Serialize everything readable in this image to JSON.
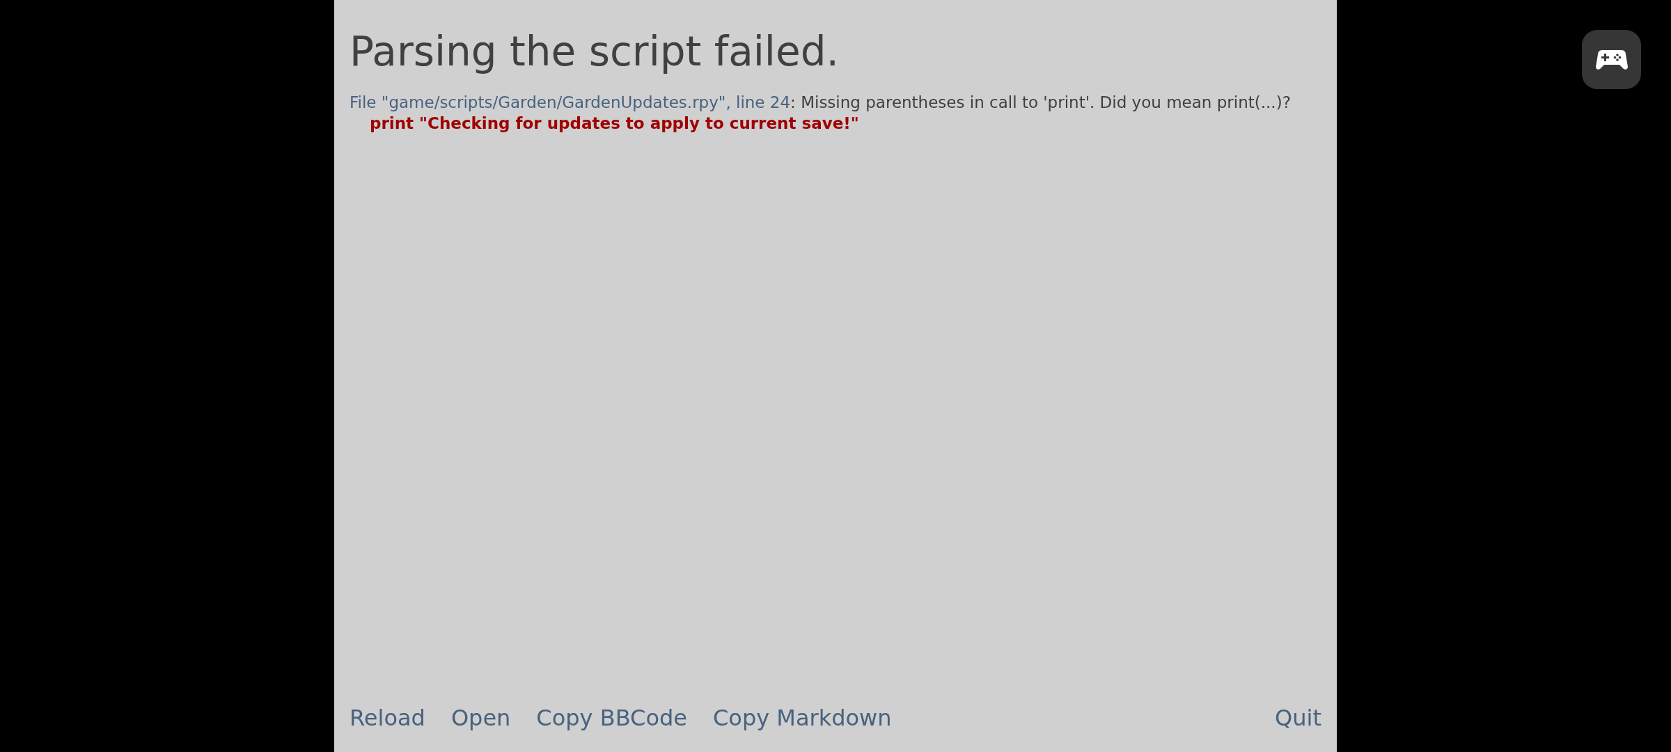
{
  "title": "Parsing the script failed.",
  "error": {
    "location": "File \"game/scripts/Garden/GardenUpdates.rpy\", line 24",
    "message": ": Missing parentheses in call to 'print'. Did you mean print(...)?",
    "code": "print \"Checking for updates to apply to current save!\""
  },
  "buttons": [
    "Reload",
    "Open",
    "Copy BBCode",
    "Copy Markdown"
  ],
  "right_buttons": [
    "Quit"
  ]
}
